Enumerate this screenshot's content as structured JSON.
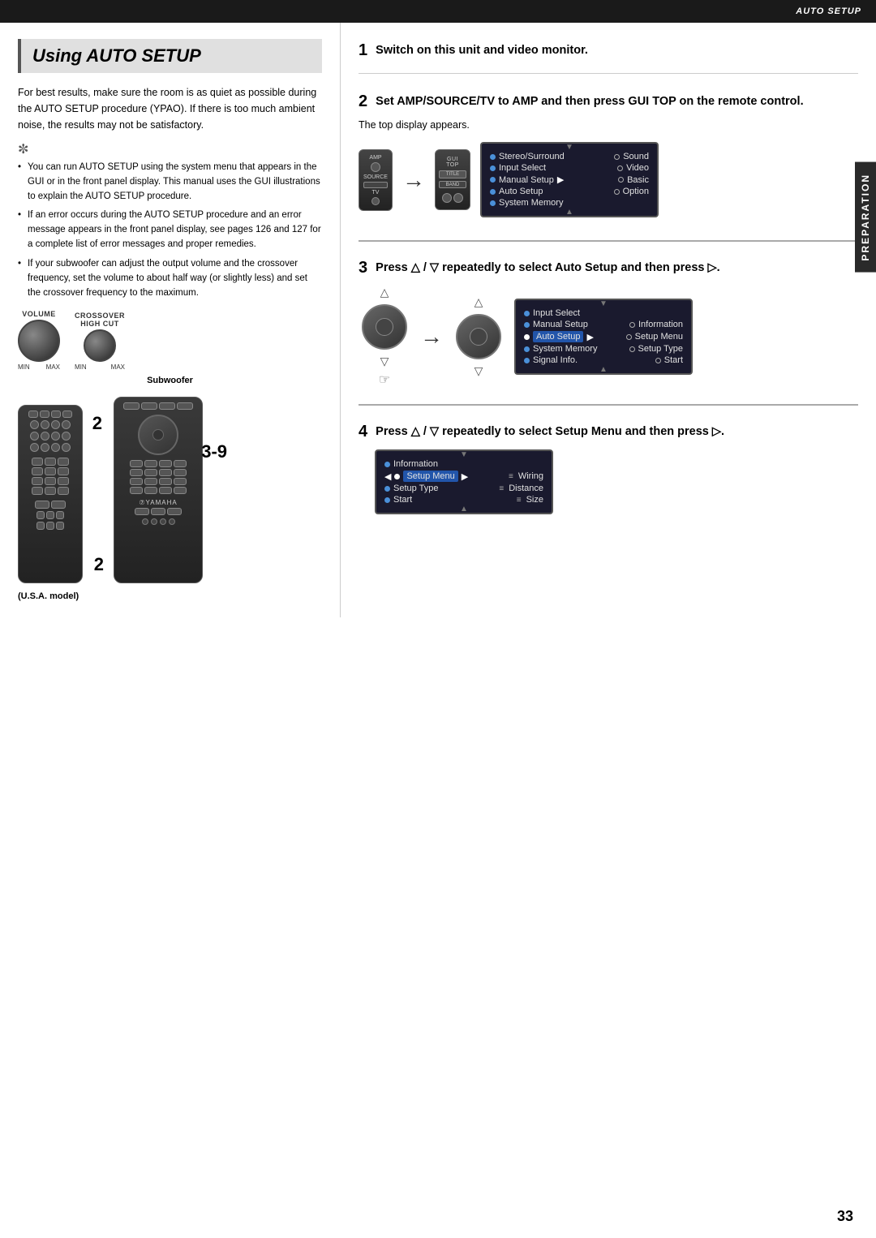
{
  "topBar": {
    "label": "AUTO SETUP"
  },
  "pageTitle": "Using AUTO SETUP",
  "leftCol": {
    "intro": "For best results, make sure the room is as quiet as possible during the AUTO SETUP procedure (YPAO). If there is too much ambient noise, the results may not be satisfactory.",
    "tipIcon": "✼",
    "bullets": [
      "You can run AUTO SETUP using the system menu that appears in the GUI or in the front panel display. This manual uses the GUI illustrations to explain the AUTO SETUP procedure.",
      "If an error occurs during the AUTO SETUP procedure and an error message appears in the front panel display, see pages 126 and 127 for a complete list of error messages and proper remedies.",
      "If your subwoofer can adjust the output volume and the crossover frequency, set the volume to about half way (or slightly less) and set the crossover frequency to the maximum."
    ],
    "subwoofer": {
      "dial1Label": "VOLUME",
      "dial2Label": "CROSSOVER\nHIGH CUT",
      "minLabel": "MIN",
      "maxLabel": "MAX",
      "label": "Subwoofer"
    },
    "modelLabel": "(U.S.A. model)",
    "remoteNumbers": {
      "num2left": "2",
      "num39": "3-9",
      "num2bottom": "2"
    }
  },
  "rightCol": {
    "step1": {
      "num": "1",
      "text": "Switch on this unit and video monitor."
    },
    "step2": {
      "num": "2",
      "text": "Set AMP/SOURCE/TV to AMP and then press GUI TOP on the remote control.",
      "subText": "The top display appears.",
      "guiScreen": {
        "items": [
          {
            "dot": "filled",
            "text": "Stereo/Surround",
            "right": "Sound"
          },
          {
            "dot": "filled",
            "text": "Input Select",
            "right": "Video"
          },
          {
            "dot": "filled",
            "text": "Manual Setup",
            "arrow": true,
            "right": "Basic"
          },
          {
            "dot": "filled",
            "text": "Auto Setup",
            "right": "Option"
          },
          {
            "dot": "filled",
            "text": "System Memory",
            "right": ""
          }
        ]
      }
    },
    "step3": {
      "num": "3",
      "text": "Press △ / ▽ repeatedly to select Auto Setup and then press ▷.",
      "guiScreen": {
        "items": [
          {
            "dot": "filled",
            "text": "Input Select",
            "right": ""
          },
          {
            "dot": "filled",
            "text": "Manual Setup",
            "right": "Information"
          },
          {
            "dot": "filled_selected",
            "text": "Auto Setup",
            "arrow": true,
            "right": "Setup Menu"
          },
          {
            "dot": "filled",
            "text": "System Memory",
            "right": "Setup Type"
          },
          {
            "dot": "filled",
            "text": "Signal Info.",
            "right": "Start"
          }
        ]
      }
    },
    "step4": {
      "num": "4",
      "text": "Press △ / ▽ repeatedly to select Setup Menu and then press ▷.",
      "guiScreen": {
        "items": [
          {
            "dot": "filled",
            "text": "Information",
            "right": ""
          },
          {
            "dot": "filled_selected",
            "text": "Setup Menu",
            "arrow": true,
            "right": "Wiring"
          },
          {
            "dot": "filled",
            "text": "Setup Type",
            "right": "Distance"
          },
          {
            "dot": "filled",
            "text": "Start",
            "right": "Size"
          }
        ]
      }
    }
  },
  "sideTab": "PREPARATION",
  "pageNumber": "33"
}
